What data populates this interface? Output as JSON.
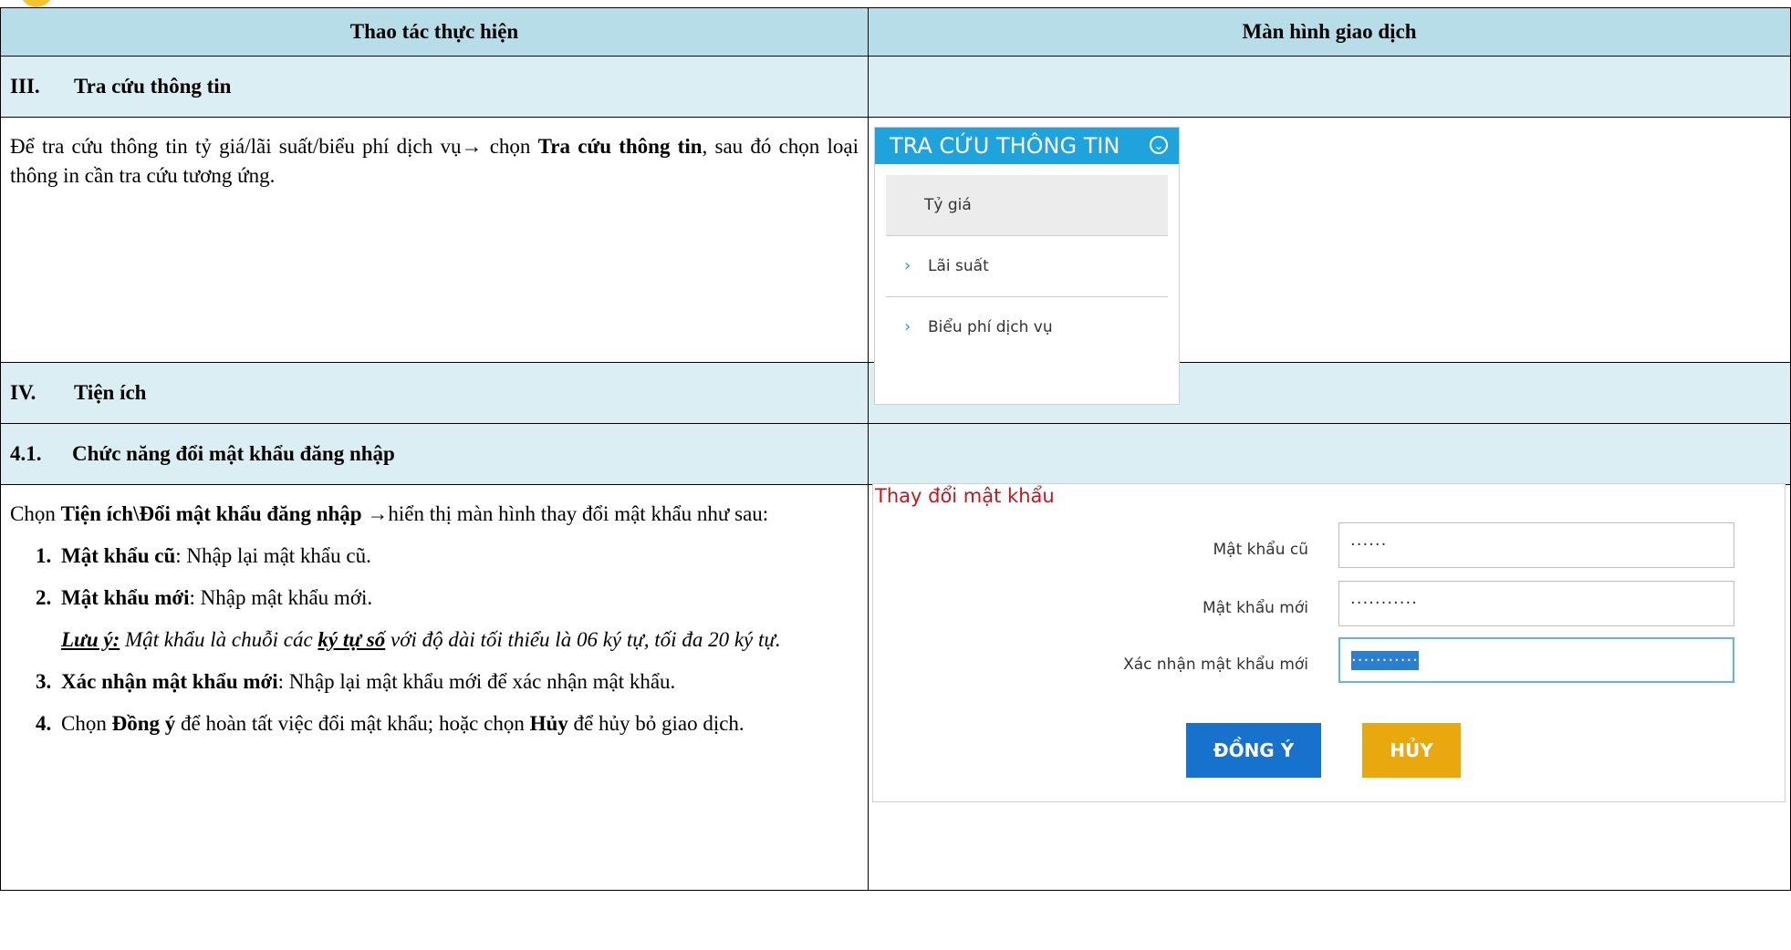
{
  "headers": {
    "col1": "Thao tác thực hiện",
    "col2": "Màn hình giao dịch"
  },
  "section3": {
    "num": "III.",
    "title": "Tra cứu thông tin"
  },
  "section3_text": {
    "part1": "Để tra cứu thông tin tỷ giá/lãi suất/biểu phí dịch vụ",
    "arrow": "→",
    "part2": " chọn ",
    "bold1": "Tra cứu thông tin",
    "part3": ", sau đó chọn loại thông in cần tra cứu tương ứng."
  },
  "tra_cuu_panel": {
    "title": "TRA CỨU THÔNG TIN",
    "toggle_icon": "chevron-down-circle",
    "items": [
      "Tỷ giá",
      "Lãi suất",
      "Biểu phí dịch vụ"
    ]
  },
  "section4": {
    "num": "IV.",
    "title": "Tiện ích"
  },
  "section41": {
    "num": "4.1.",
    "title": "Chức năng đổi mật khẩu đăng nhập"
  },
  "section41_text": {
    "part1": "Chọn ",
    "bold1": "Tiện ích\\Đổi mật khẩu đăng nhập",
    "arrow": "→",
    "part2": "hiển thị màn hình thay đổi mật khẩu như sau:"
  },
  "items": [
    {
      "num": "1.",
      "bold": "Mật khẩu cũ",
      "text": ": Nhập lại mật khẩu cũ."
    },
    {
      "num": "2.",
      "bold": "Mật khẩu mới",
      "text": ": Nhập mật khẩu mới."
    },
    {
      "num": "3.",
      "bold": "Xác nhận mật khẩu mới",
      "text": ": Nhập lại mật khẩu mới để xác nhận mật khẩu."
    },
    {
      "num": "4.",
      "pre": "Chọn ",
      "bold": "Đồng ý",
      "mid": " để hoàn tất việc đổi mật khẩu; hoặc chọn ",
      "bold2": "Hủy",
      "text": " để  hủy bỏ giao dịch."
    }
  ],
  "note": {
    "label": "Lưu ý:",
    "part1": " Mật khẩu là chuỗi các ",
    "emph": "ký tự số",
    "part2": " với độ dài tối thiểu là 06 ký tự, tối đa 20 ký tự."
  },
  "password_form": {
    "title": "Thay đổi mật khẩu",
    "fields": [
      {
        "label": "Mật khẩu cũ",
        "value": "······"
      },
      {
        "label": "Mật khẩu mới",
        "value": "···········"
      },
      {
        "label": "Xác nhận mật khẩu mới",
        "value": "···········"
      }
    ],
    "ok_label": "ĐỒNG Ý",
    "cancel_label": "HỦY"
  },
  "colors": {
    "header_bg": "#b7dde8",
    "section_bg": "#daeef3",
    "panel_title_bg": "#1ea3dc",
    "ok_button": "#1672cc",
    "cancel_button": "#e9a80e",
    "form_title": "#c4161c"
  }
}
